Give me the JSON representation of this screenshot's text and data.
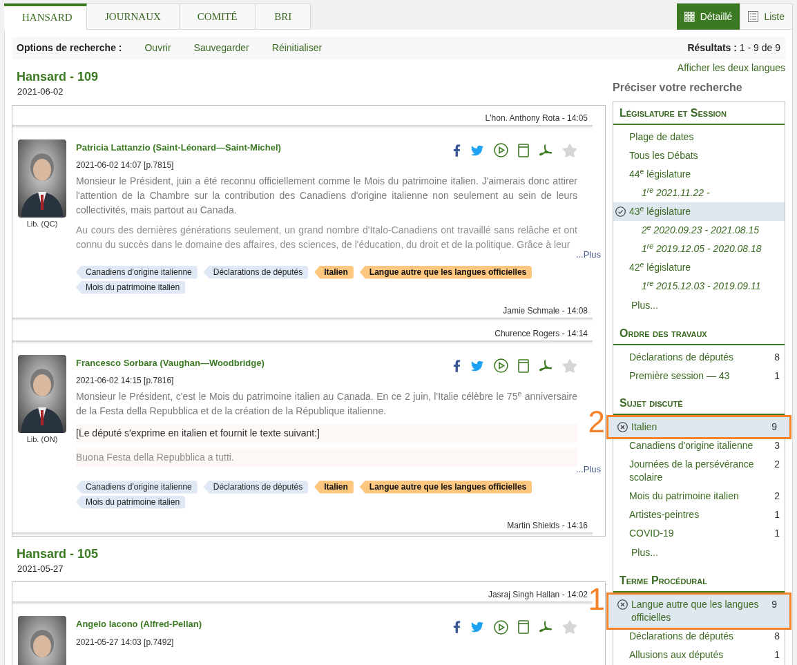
{
  "tabs": [
    {
      "label": "HANSARD",
      "selected": true
    },
    {
      "label": "JOURNAUX",
      "selected": false
    },
    {
      "label": "COMITÉ",
      "selected": false
    },
    {
      "label": "BRI",
      "selected": false
    }
  ],
  "views": [
    {
      "kind": "grid",
      "label": "Détaillé",
      "selected": true
    },
    {
      "kind": "list",
      "label": "Liste",
      "selected": false
    }
  ],
  "options_bar": {
    "label": "Options de recherche :",
    "links": [
      "Ouvrir",
      "Sauvegarder",
      "Réinitialiser"
    ],
    "results_label": "Résultats :",
    "results_value": "1 - 9 de 9"
  },
  "language_link": "Afficher les deux langues",
  "sittings": [
    {
      "title": "Hansard - 109",
      "date": "2021-06-02",
      "items": [
        {
          "kind": "speaker",
          "text": "L'hon. Anthony Rota - 14:05"
        },
        {
          "kind": "intervention",
          "name": "Patricia Lattanzio (Saint-Léonard—Saint-Michel)",
          "datetime": "2021-06-02 14:07 [p.7815]",
          "party": "Lib. (QC)",
          "starred": false,
          "paragraphs": [
            {
              "kind": "text",
              "faded": false,
              "text": "Monsieur le Président, juin a été reconnu officiellement comme le Mois du patrimoine italien. J'aimerais donc attirer l'attention de la Chambre sur la contribution des Canadiens d'origine italienne non seulement au sein de leurs collectivités, mais partout au Canada."
            },
            {
              "kind": "text",
              "faded": true,
              "text": "Au cours des dernières générations seulement, un grand nombre d'Italo-Canadiens ont travaillé sans relâche et ont connu du succès dans le domaine des affaires, des sciences, de l'éducation, du droit et de la politique. Grâce à leur"
            }
          ],
          "more": "...Plus",
          "tags": [
            {
              "label": "Canadiens d'origine italienne",
              "highlighted": false
            },
            {
              "label": "Déclarations de députés",
              "highlighted": false
            },
            {
              "label": "Italien",
              "highlighted": true
            },
            {
              "label": "Langue autre que les langues officielles",
              "highlighted": true
            },
            {
              "label": "Mois du patrimoine italien",
              "highlighted": false
            }
          ]
        },
        {
          "kind": "speaker",
          "text": "Jamie Schmale - 14:08"
        },
        {
          "kind": "speaker",
          "text": "Churence Rogers - 14:14"
        },
        {
          "kind": "intervention",
          "name": "Francesco Sorbara (Vaughan—Woodbridge)",
          "datetime": "2021-06-02 14:15 [p.7816]",
          "party": "Lib. (ON)",
          "starred": false,
          "paragraphs": [
            {
              "kind": "text",
              "faded": false,
              "text": "Monsieur le Président, c'est le Mois du patrimoine italien au Canada. En ce 2 juin, l'Italie célèbre le 75$^{e}$ anniversaire de la Festa della Repubblica et de la création de la République italienne."
            },
            {
              "kind": "note",
              "faded": false,
              "text": "[Le député s'exprime en italien et fournit le texte suivant:]"
            },
            {
              "kind": "note",
              "faded": true,
              "text": "Buona Festa della Repubblica a tutti."
            }
          ],
          "more": "...Plus",
          "tags": [
            {
              "label": "Canadiens d'origine italienne",
              "highlighted": false
            },
            {
              "label": "Déclarations de députés",
              "highlighted": false
            },
            {
              "label": "Italien",
              "highlighted": true
            },
            {
              "label": "Langue autre que les langues officielles",
              "highlighted": true
            },
            {
              "label": "Mois du patrimoine italien",
              "highlighted": false
            }
          ]
        },
        {
          "kind": "speaker",
          "text": "Martin Shields - 14:16"
        }
      ]
    },
    {
      "title": "Hansard - 105",
      "date": "2021-05-27",
      "items": [
        {
          "kind": "speaker",
          "text": "Jasraj Singh Hallan - 14:02"
        },
        {
          "kind": "intervention",
          "name": "Angelo Iacono (Alfred-Pellan)",
          "datetime": "2021-05-27 14:03 [p.7492]",
          "starred": false
        }
      ]
    }
  ],
  "refine": {
    "title": "Préciser votre recherche",
    "sections": [
      {
        "title": "Législature et Session",
        "kind": "radio",
        "items": [
          {
            "label": "Plage de dates",
            "selected": false
          },
          {
            "label": "Tous les Débats",
            "selected": false
          },
          {
            "label": "44$^{e}$ législature",
            "selected": false,
            "children": [
              {
                "label": "1$^{re}$ 2021.11.22 -",
                "selected": false
              }
            ]
          },
          {
            "label": "43$^{e}$ législature",
            "selected": true,
            "children": [
              {
                "label": "2$^{e}$ 2020.09.23 - 2021.08.15",
                "selected": false
              },
              {
                "label": "1$^{re}$ 2019.12.05 - 2020.08.18",
                "selected": false
              }
            ]
          },
          {
            "label": "42$^{e}$ législature",
            "selected": false,
            "children": [
              {
                "label": "1$^{re}$ 2015.12.03 - 2019.09.11",
                "selected": false
              }
            ]
          }
        ],
        "more": "Plus..."
      },
      {
        "title": "Ordre des travaux",
        "kind": "facet",
        "items": [
          {
            "label": "Déclarations de députés",
            "count": "8",
            "selected": false
          },
          {
            "label": "Première session — 43",
            "count": "1",
            "selected": false
          }
        ]
      },
      {
        "title": "Sujet discuté",
        "kind": "facet",
        "items": [
          {
            "label": "Italien",
            "count": "9",
            "selected": true,
            "callout": "2"
          },
          {
            "label": "Canadiens d'origine italienne",
            "count": "3",
            "selected": false
          },
          {
            "label": "Journées de la persévérance scolaire",
            "count": "2",
            "selected": false
          },
          {
            "label": "Mois du patrimoine italien",
            "count": "2",
            "selected": false
          },
          {
            "label": "Artistes-peintres",
            "count": "1",
            "selected": false
          },
          {
            "label": "COVID-19",
            "count": "1",
            "selected": false
          }
        ],
        "more": "Plus..."
      },
      {
        "title": "Terme Procédural",
        "kind": "facet",
        "items": [
          {
            "label": "Langue autre que les langues officielles",
            "count": "9",
            "selected": true,
            "callout": "1"
          },
          {
            "label": "Déclarations de députés",
            "count": "8",
            "selected": false
          },
          {
            "label": "Allusions aux députés",
            "count": "1",
            "selected": false
          }
        ]
      }
    ]
  }
}
